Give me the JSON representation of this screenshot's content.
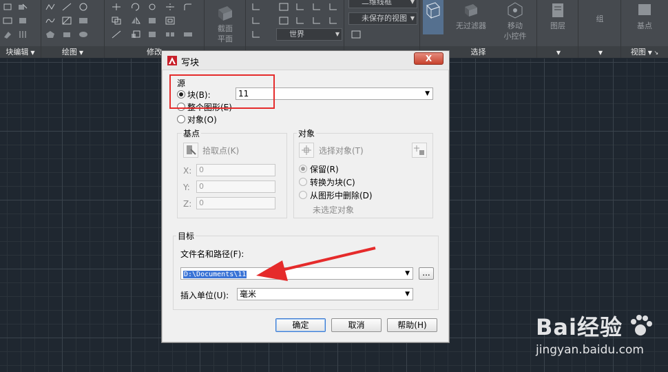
{
  "ribbon": {
    "panels": [
      {
        "label": "块编辑",
        "has_arrow": true
      },
      {
        "label": "绘图",
        "has_arrow": true
      },
      {
        "label": "修改",
        "has_arrow": false
      },
      {
        "label": "",
        "has_arrow": false
      },
      {
        "label": "",
        "has_arrow": false
      },
      {
        "label": "",
        "has_arrow": false
      },
      {
        "label": "选择",
        "has_arrow": false
      },
      {
        "label": "",
        "has_arrow": true
      },
      {
        "label": "",
        "has_arrow": true
      },
      {
        "label": "视图",
        "has_arrow": true
      }
    ],
    "buttons": {
      "section_plane": "截面\n平面",
      "no_filter": "无过滤器",
      "move_gizmo": "移动\n小控件",
      "layers": "图层",
      "group": "组",
      "base": "基点"
    },
    "combos": {
      "visual_style": "二维线框",
      "view": "未保存的视图",
      "ucs": "世界"
    }
  },
  "dialog": {
    "title": "写块",
    "close_label": "X",
    "source": {
      "title": "源",
      "block_label": "块(B):",
      "block_value": "11",
      "entire_drawing_label": "整个图形(E)",
      "objects_label": "对象(O)",
      "block_selected": true
    },
    "base_point": {
      "title": "基点",
      "pick_label": "拾取点(K)",
      "x_label": "X:",
      "y_label": "Y:",
      "z_label": "Z:",
      "x_value": "0",
      "y_value": "0",
      "z_value": "0"
    },
    "objects": {
      "title": "对象",
      "select_label": "选择对象(T)",
      "retain_label": "保留(R)",
      "convert_label": "转换为块(C)",
      "delete_label": "从图形中删除(D)",
      "status": "未选定对象"
    },
    "destination": {
      "title": "目标",
      "path_label": "文件名和路径(F):",
      "path_value": "D:\\Documents\\11",
      "browse_label": "...",
      "units_label": "插入单位(U):",
      "units_value": "毫米"
    },
    "buttons": {
      "ok": "确定",
      "cancel": "取消",
      "help": "帮助(H)"
    }
  },
  "watermark": {
    "brand": "Bai经验",
    "url": "jingyan.baidu.com"
  },
  "colors": {
    "accent_red": "#e52b2b",
    "canvas_bg": "#1f2730",
    "ribbon_bg": "#464a4f"
  }
}
